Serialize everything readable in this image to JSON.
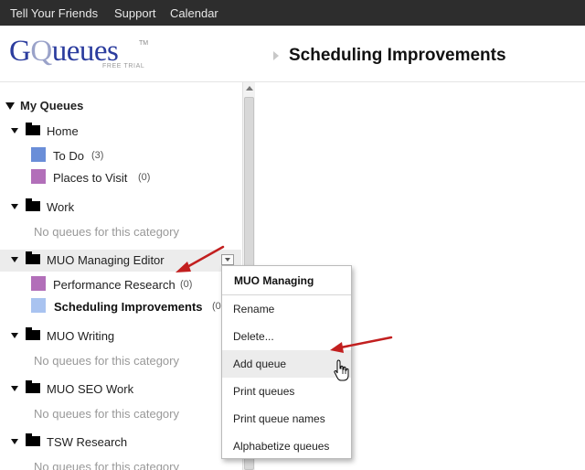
{
  "topnav": {
    "links": [
      "Tell Your Friends",
      "Support",
      "Calendar"
    ]
  },
  "logo": {
    "text_g": "G",
    "text_q": "Q",
    "text_rest": "ueues",
    "tm": "TM",
    "subtitle": "FREE TRIAL"
  },
  "page": {
    "title": "Scheduling Improvements"
  },
  "sidebar": {
    "title": "My Queues",
    "categories": [
      {
        "label": "Home",
        "queues": [
          {
            "label": "To Do",
            "count": "(3)",
            "color": "#6a8ed8"
          },
          {
            "label": "Places to Visit",
            "count": "(0)",
            "color": "#b26fb9"
          }
        ]
      },
      {
        "label": "Work",
        "empty": "No queues for this category"
      },
      {
        "label": "MUO Managing Editor",
        "queues": [
          {
            "label": "Performance Research",
            "count": "(0)",
            "color": "#b26fb9"
          },
          {
            "label": "Scheduling Improvements",
            "count": "(0",
            "color": "#a9c3f0"
          }
        ]
      },
      {
        "label": "MUO Writing",
        "empty": "No queues for this category"
      },
      {
        "label": "MUO SEO Work",
        "empty": "No queues for this category"
      },
      {
        "label": "TSW Research",
        "empty": "No queues for this category"
      }
    ]
  },
  "context_menu": {
    "header": "MUO Managing",
    "items": [
      "Rename",
      "Delete...",
      "Add queue",
      "Print queues",
      "Print queue names",
      "Alphabetize queues"
    ]
  },
  "colors": {
    "topbar": "#2d2d2d",
    "logo_blue": "#2b3c9e",
    "annotation_arrow": "#c21f1f",
    "hover": "#ececec"
  },
  "icons": [
    "expand-triangle-icon",
    "folder-icon",
    "dropdown-arrow-icon",
    "hand-cursor-icon",
    "red-arrow-annotation"
  ]
}
